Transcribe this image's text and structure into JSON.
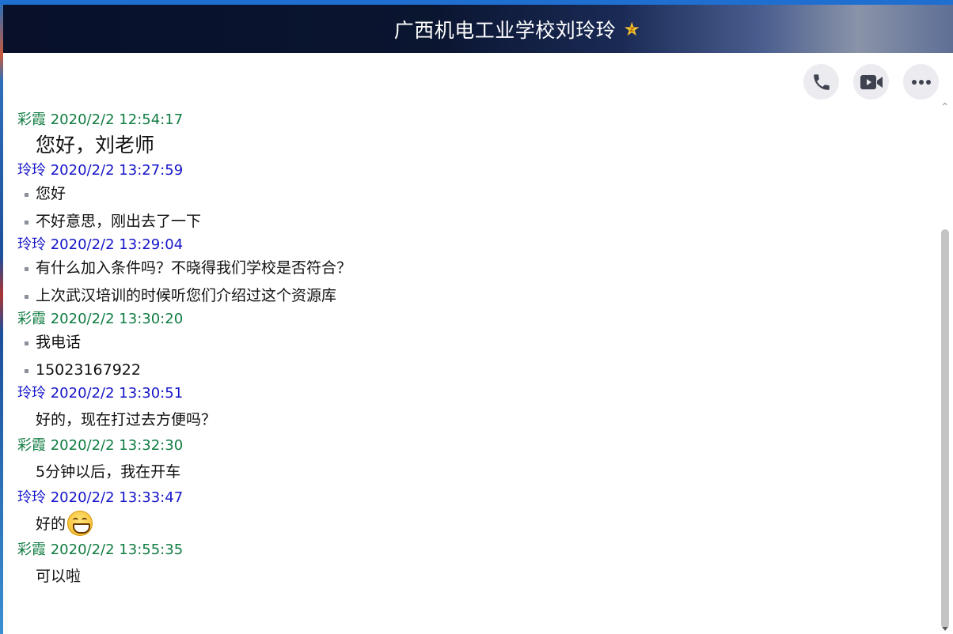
{
  "window": {
    "title": "广西机电工业学校刘玲玲",
    "badge_icon": "star-z-badge-icon",
    "badge_text": "z"
  },
  "toolbar": {
    "buttons": [
      {
        "name": "voice-call-button",
        "icon": "phone-icon"
      },
      {
        "name": "video-call-button",
        "icon": "video-camera-icon"
      },
      {
        "name": "more-button",
        "icon": "more-icon"
      }
    ]
  },
  "colors": {
    "caixia_name": "#107c41",
    "lingling_name": "#1515c8",
    "message_text": "#111111",
    "title_bar_start": "#08102a",
    "toolbar_button_bg": "#ebebf0"
  },
  "messages": [
    {
      "sender": "彩霞",
      "time": "2020/2/2 12:54:17",
      "lines": [
        "您好，刘老师"
      ]
    },
    {
      "sender": "玲玲",
      "time": "2020/2/2 13:27:59",
      "lines": [
        "您好",
        "不好意思，刚出去了一下"
      ]
    },
    {
      "sender": "玲玲",
      "time": "2020/2/2 13:29:04",
      "lines": [
        "有什么加入条件吗？不晓得我们学校是否符合？",
        "上次武汉培训的时候听您们介绍过这个资源库"
      ]
    },
    {
      "sender": "彩霞",
      "time": "2020/2/2 13:30:20",
      "lines": [
        "我电话",
        "15023167922"
      ]
    },
    {
      "sender": "玲玲",
      "time": "2020/2/2 13:30:51",
      "lines": [
        "好的，现在打过去方便吗？"
      ]
    },
    {
      "sender": "彩霞",
      "time": "2020/2/2 13:32:30",
      "lines": [
        "5分钟以后，我在开车"
      ]
    },
    {
      "sender": "玲玲",
      "time": "2020/2/2 13:33:47",
      "lines": [
        "好的"
      ],
      "emoji": "grinning-face-emoji"
    },
    {
      "sender": "彩霞",
      "time": "2020/2/2 13:55:35",
      "lines": [
        "可以啦"
      ]
    }
  ]
}
